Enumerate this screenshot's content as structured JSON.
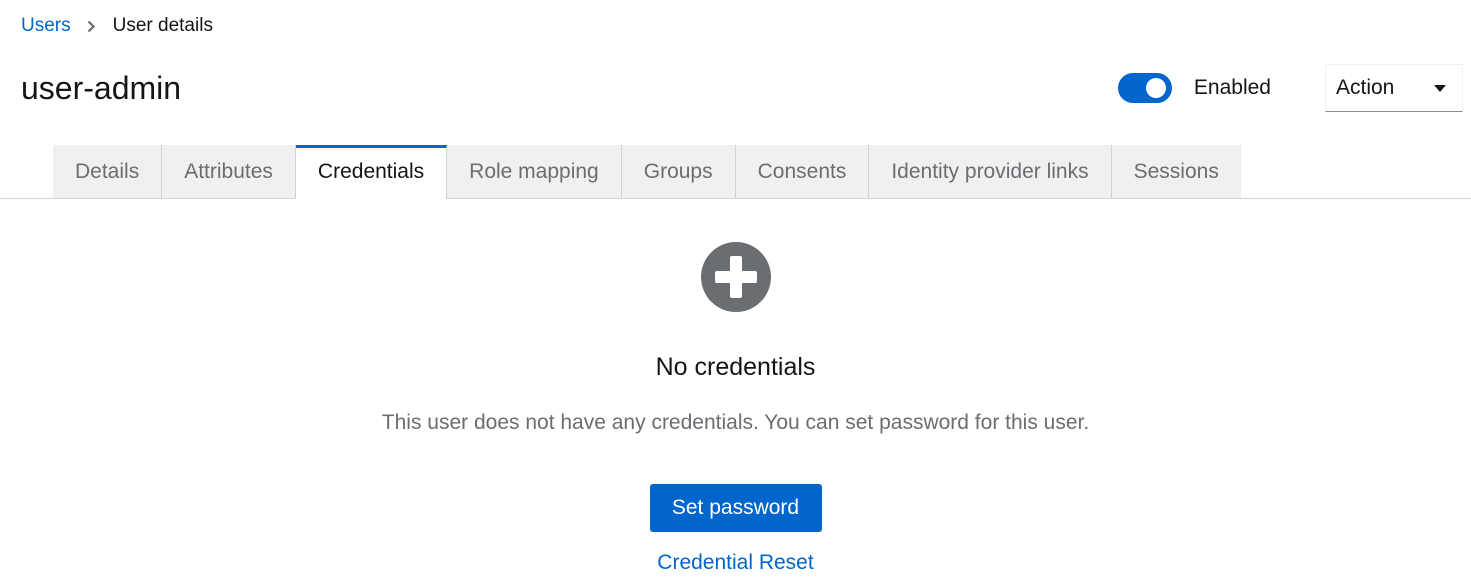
{
  "breadcrumb": {
    "parent": "Users",
    "current": "User details"
  },
  "header": {
    "title": "user-admin",
    "enabled_label": "Enabled",
    "enabled": true,
    "action_label": "Action"
  },
  "tabs": [
    {
      "label": "Details",
      "active": false
    },
    {
      "label": "Attributes",
      "active": false
    },
    {
      "label": "Credentials",
      "active": true
    },
    {
      "label": "Role mapping",
      "active": false
    },
    {
      "label": "Groups",
      "active": false
    },
    {
      "label": "Consents",
      "active": false
    },
    {
      "label": "Identity provider links",
      "active": false
    },
    {
      "label": "Sessions",
      "active": false
    }
  ],
  "empty_state": {
    "icon": "plus-circle-icon",
    "title": "No credentials",
    "body": "This user does not have any credentials. You can set password for this user.",
    "primary_button": "Set password",
    "secondary_link": "Credential Reset"
  },
  "colors": {
    "accent": "#0066cc",
    "icon_gray": "#6a6e73",
    "tab_bg": "#f0f0f0"
  }
}
